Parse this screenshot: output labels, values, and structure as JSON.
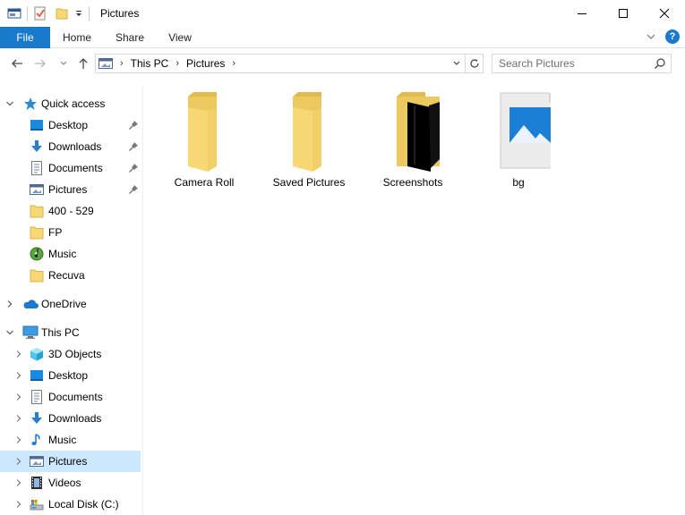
{
  "window": {
    "title": "Pictures",
    "minimize_icon": "minimize-icon",
    "maximize_icon": "maximize-icon",
    "close_icon": "close-icon"
  },
  "ribbon": {
    "tabs": [
      {
        "label": "File",
        "active": true
      },
      {
        "label": "Home"
      },
      {
        "label": "Share"
      },
      {
        "label": "View"
      }
    ],
    "help_label": "?"
  },
  "address": {
    "crumbs": [
      "This PC",
      "Pictures"
    ]
  },
  "search": {
    "placeholder": "Search Pictures"
  },
  "nav": {
    "quick_access": {
      "label": "Quick access",
      "items": [
        {
          "label": "Desktop",
          "pinned": true
        },
        {
          "label": "Downloads",
          "pinned": true
        },
        {
          "label": "Documents",
          "pinned": true
        },
        {
          "label": "Pictures",
          "pinned": true
        },
        {
          "label": "400 - 529"
        },
        {
          "label": "FP"
        },
        {
          "label": "Music"
        },
        {
          "label": "Recuva"
        }
      ]
    },
    "onedrive": {
      "label": "OneDrive"
    },
    "this_pc": {
      "label": "This PC",
      "items": [
        {
          "label": "3D Objects"
        },
        {
          "label": "Desktop"
        },
        {
          "label": "Documents"
        },
        {
          "label": "Downloads"
        },
        {
          "label": "Music"
        },
        {
          "label": "Pictures",
          "selected": true
        },
        {
          "label": "Videos"
        },
        {
          "label": "Local Disk (C:)"
        }
      ]
    }
  },
  "content": {
    "items": [
      {
        "label": "Camera Roll",
        "kind": "folder"
      },
      {
        "label": "Saved Pictures",
        "kind": "folder"
      },
      {
        "label": "Screenshots",
        "kind": "folder"
      },
      {
        "label": "bg",
        "kind": "image-file"
      }
    ]
  },
  "colors": {
    "accent": "#1979ca",
    "selection": "#cce8ff",
    "folder": "#f8d775"
  }
}
